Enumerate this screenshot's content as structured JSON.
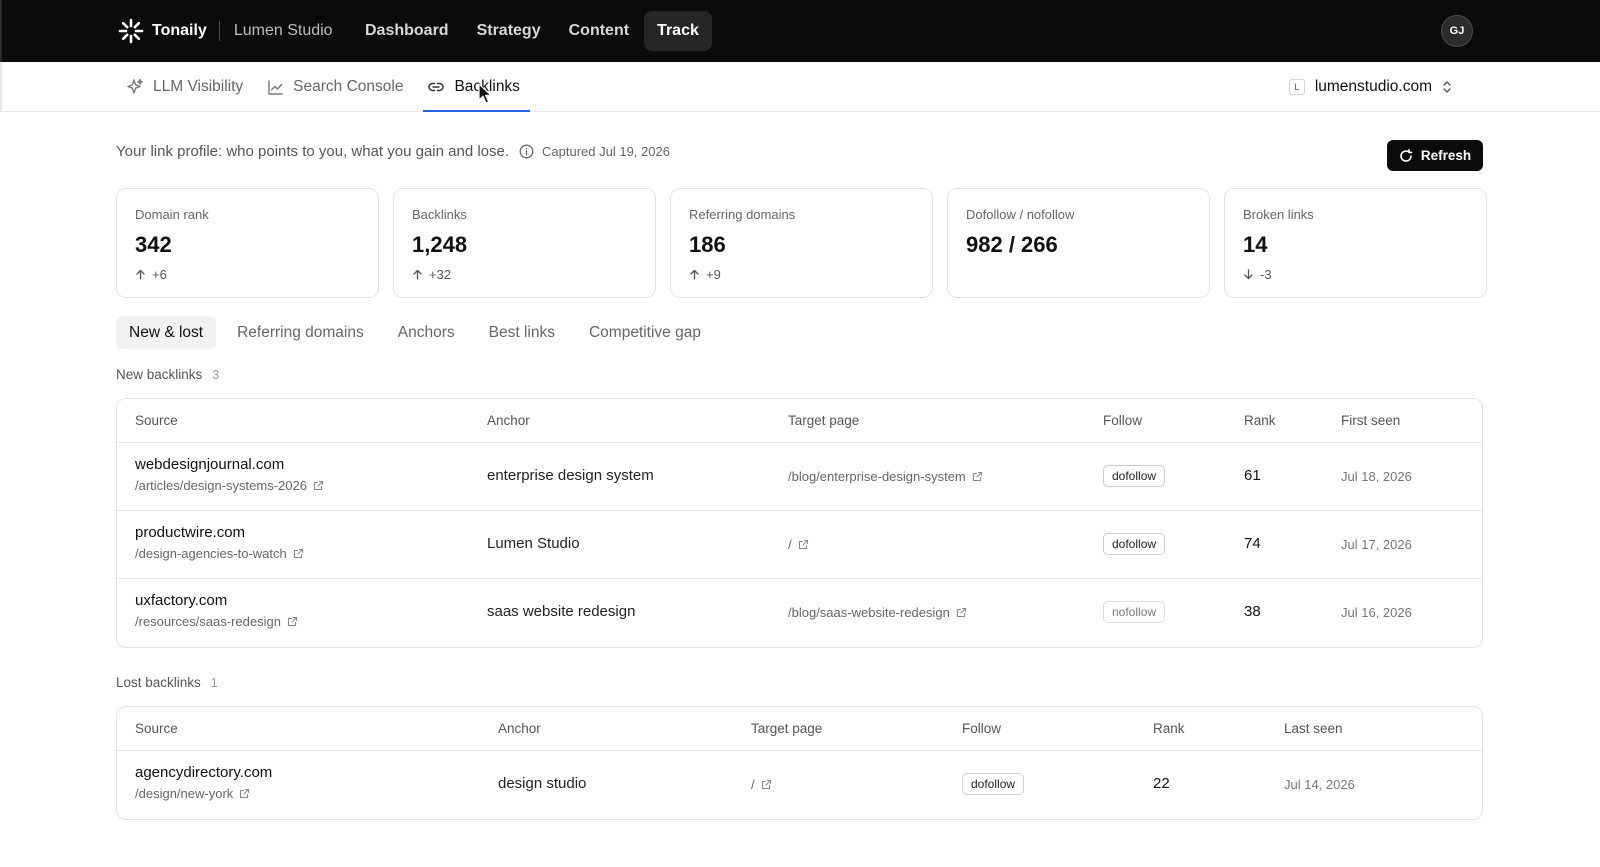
{
  "topbar": {
    "brand": "Tonaily",
    "workspace": "Lumen Studio",
    "nav": [
      "Dashboard",
      "Strategy",
      "Content",
      "Track"
    ],
    "active_nav": "Track",
    "avatar_initials": "GJ"
  },
  "subnav": {
    "tabs": [
      {
        "label": "LLM Visibility",
        "icon": "sparkle-icon"
      },
      {
        "label": "Search Console",
        "icon": "chart-line-icon"
      },
      {
        "label": "Backlinks",
        "icon": "link-icon"
      }
    ],
    "active_tab": "Backlinks",
    "domain_badge": "L",
    "domain": "lumenstudio.com"
  },
  "intro": {
    "text": "Your link profile: who points to you, what you gain and lose.",
    "captured": "Captured Jul 19, 2026",
    "refresh_label": "Refresh"
  },
  "stats": [
    {
      "label": "Domain rank",
      "value": "342",
      "delta": "+6",
      "direction": "up"
    },
    {
      "label": "Backlinks",
      "value": "1,248",
      "delta": "+32",
      "direction": "up"
    },
    {
      "label": "Referring domains",
      "value": "186",
      "delta": "+9",
      "direction": "up"
    },
    {
      "label": "Dofollow / nofollow",
      "value": "982 / 266",
      "delta": "",
      "direction": "none"
    },
    {
      "label": "Broken links",
      "value": "14",
      "delta": "-3",
      "direction": "down"
    }
  ],
  "section_tabs": [
    "New & lost",
    "Referring domains",
    "Anchors",
    "Best links",
    "Competitive gap"
  ],
  "active_section_tab": "New & lost",
  "new_backlinks": {
    "title": "New backlinks",
    "count": "3",
    "columns": [
      "Source",
      "Anchor",
      "Target page",
      "Follow",
      "Rank",
      "First seen"
    ],
    "rows": [
      {
        "domain": "webdesignjournal.com",
        "path": "/articles/design-systems-2026",
        "anchor": "enterprise design system",
        "target": "/blog/enterprise-design-system",
        "follow": "dofollow",
        "rank": "61",
        "date": "Jul 18, 2026"
      },
      {
        "domain": "productwire.com",
        "path": "/design-agencies-to-watch",
        "anchor": "Lumen Studio",
        "target": "/",
        "follow": "dofollow",
        "rank": "74",
        "date": "Jul 17, 2026"
      },
      {
        "domain": "uxfactory.com",
        "path": "/resources/saas-redesign",
        "anchor": "saas website redesign",
        "target": "/blog/saas-website-redesign",
        "follow": "nofollow",
        "rank": "38",
        "date": "Jul 16, 2026"
      }
    ]
  },
  "lost_backlinks": {
    "title": "Lost backlinks",
    "count": "1",
    "columns": [
      "Source",
      "Anchor",
      "Target page",
      "Follow",
      "Rank",
      "Last seen"
    ],
    "rows": [
      {
        "domain": "agencydirectory.com",
        "path": "/design/new-york",
        "anchor": "design studio",
        "target": "/",
        "follow": "dofollow",
        "rank": "22",
        "date": "Jul 14, 2026"
      }
    ]
  }
}
